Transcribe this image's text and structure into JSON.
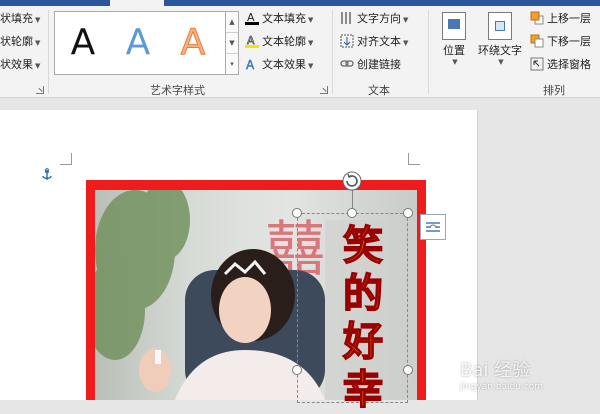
{
  "ribbon": {
    "left_group": {
      "items": [
        {
          "label": "状填充"
        },
        {
          "label": "状轮廓"
        },
        {
          "label": "状效果"
        }
      ]
    },
    "wordart_styles": {
      "group_label": "艺术字样式",
      "gallery": [
        "A",
        "A",
        "A"
      ],
      "text_fill": "文本填充",
      "text_outline": "文本轮廓",
      "text_effects": "文本效果"
    },
    "text": {
      "group_label": "文本",
      "direction": "文字方向",
      "align": "对齐文本",
      "link": "创建链接"
    },
    "arrange": {
      "group_label": "排列",
      "position": "位置",
      "wrap": "环绕文字",
      "bring_forward": "上移一层",
      "send_backward": "下移一层",
      "selection_pane": "选择窗格"
    }
  },
  "document": {
    "vertical_text": [
      "笑",
      "的",
      "好",
      "幸"
    ]
  },
  "watermark": {
    "text": "Bai 经验",
    "sub": "jingyan.baidu.com"
  },
  "colors": {
    "ribbon_accent": "#2b579a",
    "frame_red": "#ee1c1c",
    "text_fill": "#e8b800",
    "text_outline": "#9b0000"
  }
}
